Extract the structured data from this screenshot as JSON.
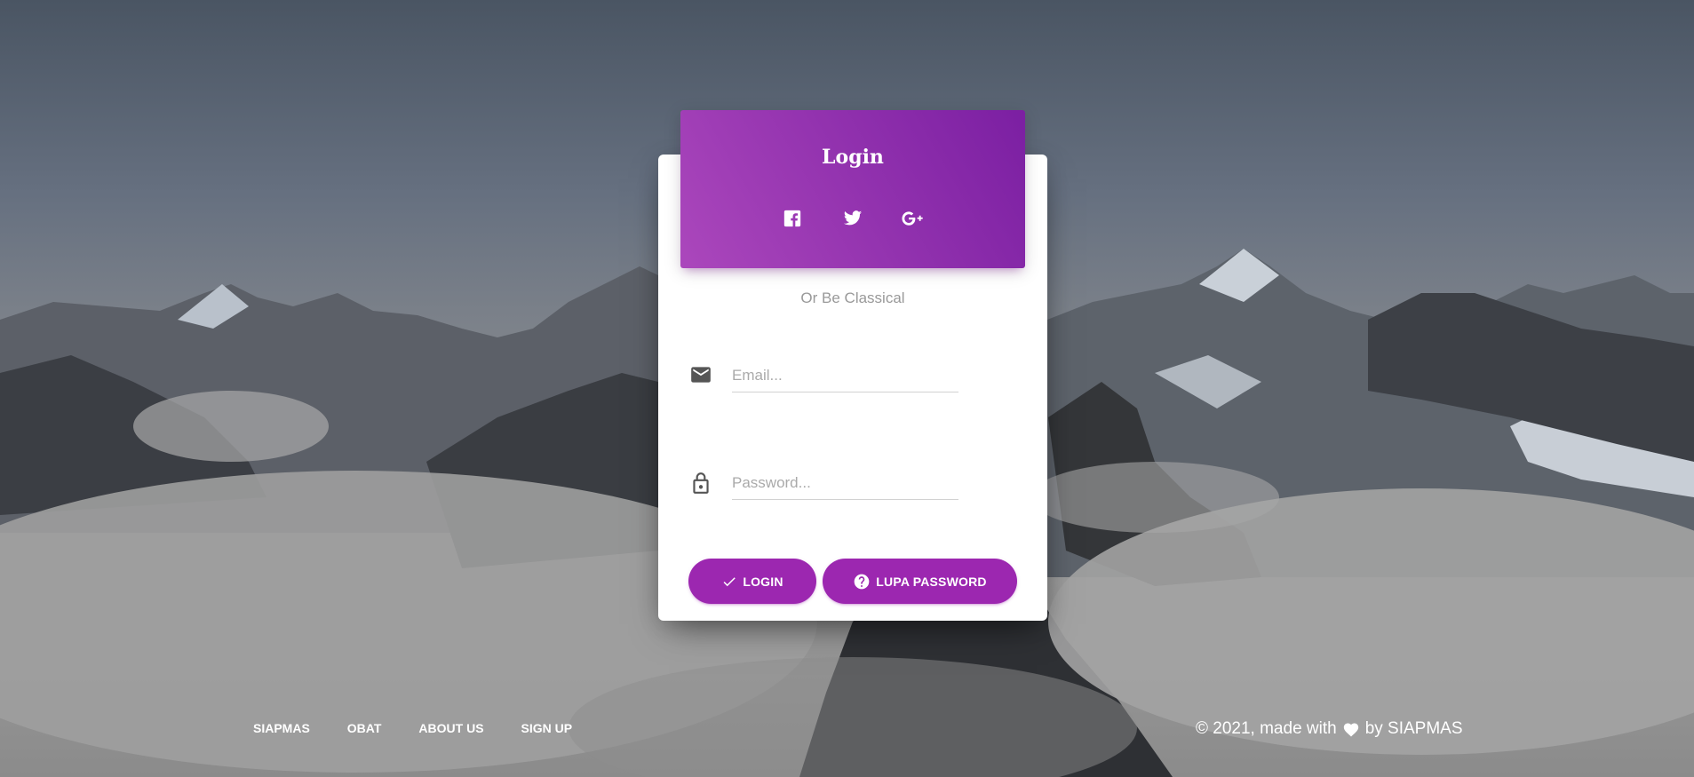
{
  "header": {
    "title": "Login",
    "social": [
      {
        "icon": "facebook-icon"
      },
      {
        "icon": "twitter-icon"
      },
      {
        "icon": "google-plus-icon"
      }
    ]
  },
  "subtitle": "Or Be Classical",
  "form": {
    "email_placeholder": "Email...",
    "email_value": "",
    "password_placeholder": "Password...",
    "password_value": ""
  },
  "buttons": {
    "login_label": "LOGIN",
    "forgot_label": "LUPA PASSWORD"
  },
  "footer": {
    "nav": [
      "SIAPMAS",
      "OBAT",
      "ABOUT US",
      "SIGN UP"
    ],
    "copyright_prefix": "© 2021, made with",
    "copyright_suffix": "by SIAPMAS"
  },
  "colors": {
    "accent": "#9c27b0",
    "header_gradient_start": "#ab47bc",
    "header_gradient_end": "#7b1fa2"
  }
}
